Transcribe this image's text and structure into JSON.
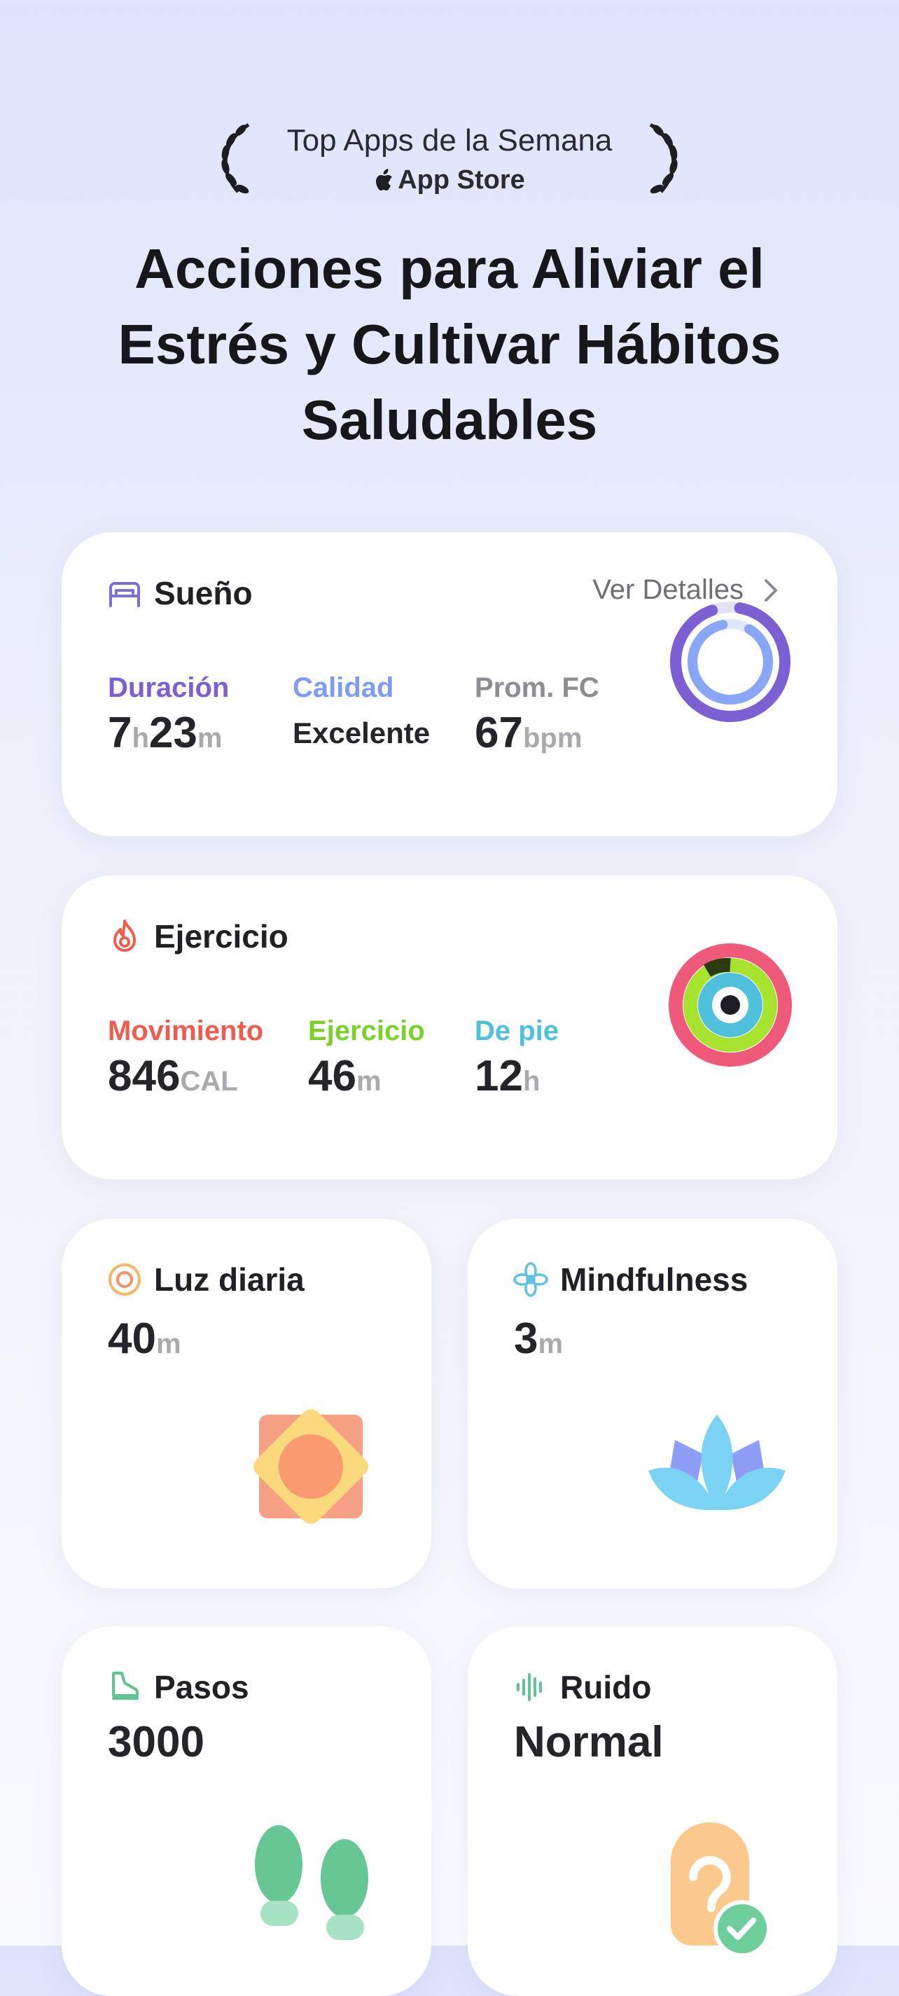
{
  "award": {
    "title": "Top Apps de la Semana",
    "store": "App Store",
    "laurel_icon": "laurel-icon",
    "apple_icon": "apple-logo-icon"
  },
  "headline": {
    "line1": "Acciones para Aliviar el",
    "line2": "Estrés y Cultivar Hábitos",
    "line3": "Saludables"
  },
  "sleep": {
    "title": "Sueño",
    "icon": "bed-icon",
    "details_label": "Ver Detalles",
    "duration": {
      "label": "Duración",
      "hours": "7",
      "hours_unit": "h",
      "minutes": "23",
      "minutes_unit": "m",
      "color": "#7b5fd3"
    },
    "quality": {
      "label": "Calidad",
      "value": "Excelente",
      "color": "#7f9cf5"
    },
    "heart": {
      "label": "Prom. FC",
      "value": "67",
      "unit": "bpm",
      "color": "#8d8d95"
    }
  },
  "exercise": {
    "title": "Ejercicio",
    "icon": "flame-icon",
    "move": {
      "label": "Movimiento",
      "value": "846",
      "unit": "CAL",
      "color": "#ee5d4f"
    },
    "workout": {
      "label": "Ejercicio",
      "value": "46",
      "unit": "m",
      "color": "#7bd12a"
    },
    "stand": {
      "label": "De pie",
      "value": "12",
      "unit": "h",
      "color": "#4fc1dd"
    }
  },
  "daylight": {
    "title": "Luz diaria",
    "icon": "sun-ring-icon",
    "value": "40",
    "unit": "m"
  },
  "mindfulness": {
    "title": "Mindfulness",
    "icon": "flower-icon",
    "value": "3",
    "unit": "m"
  },
  "steps": {
    "title": "Pasos",
    "icon": "shoe-icon",
    "value": "3000"
  },
  "noise": {
    "title": "Ruido",
    "icon": "sound-wave-icon",
    "value": "Normal"
  }
}
